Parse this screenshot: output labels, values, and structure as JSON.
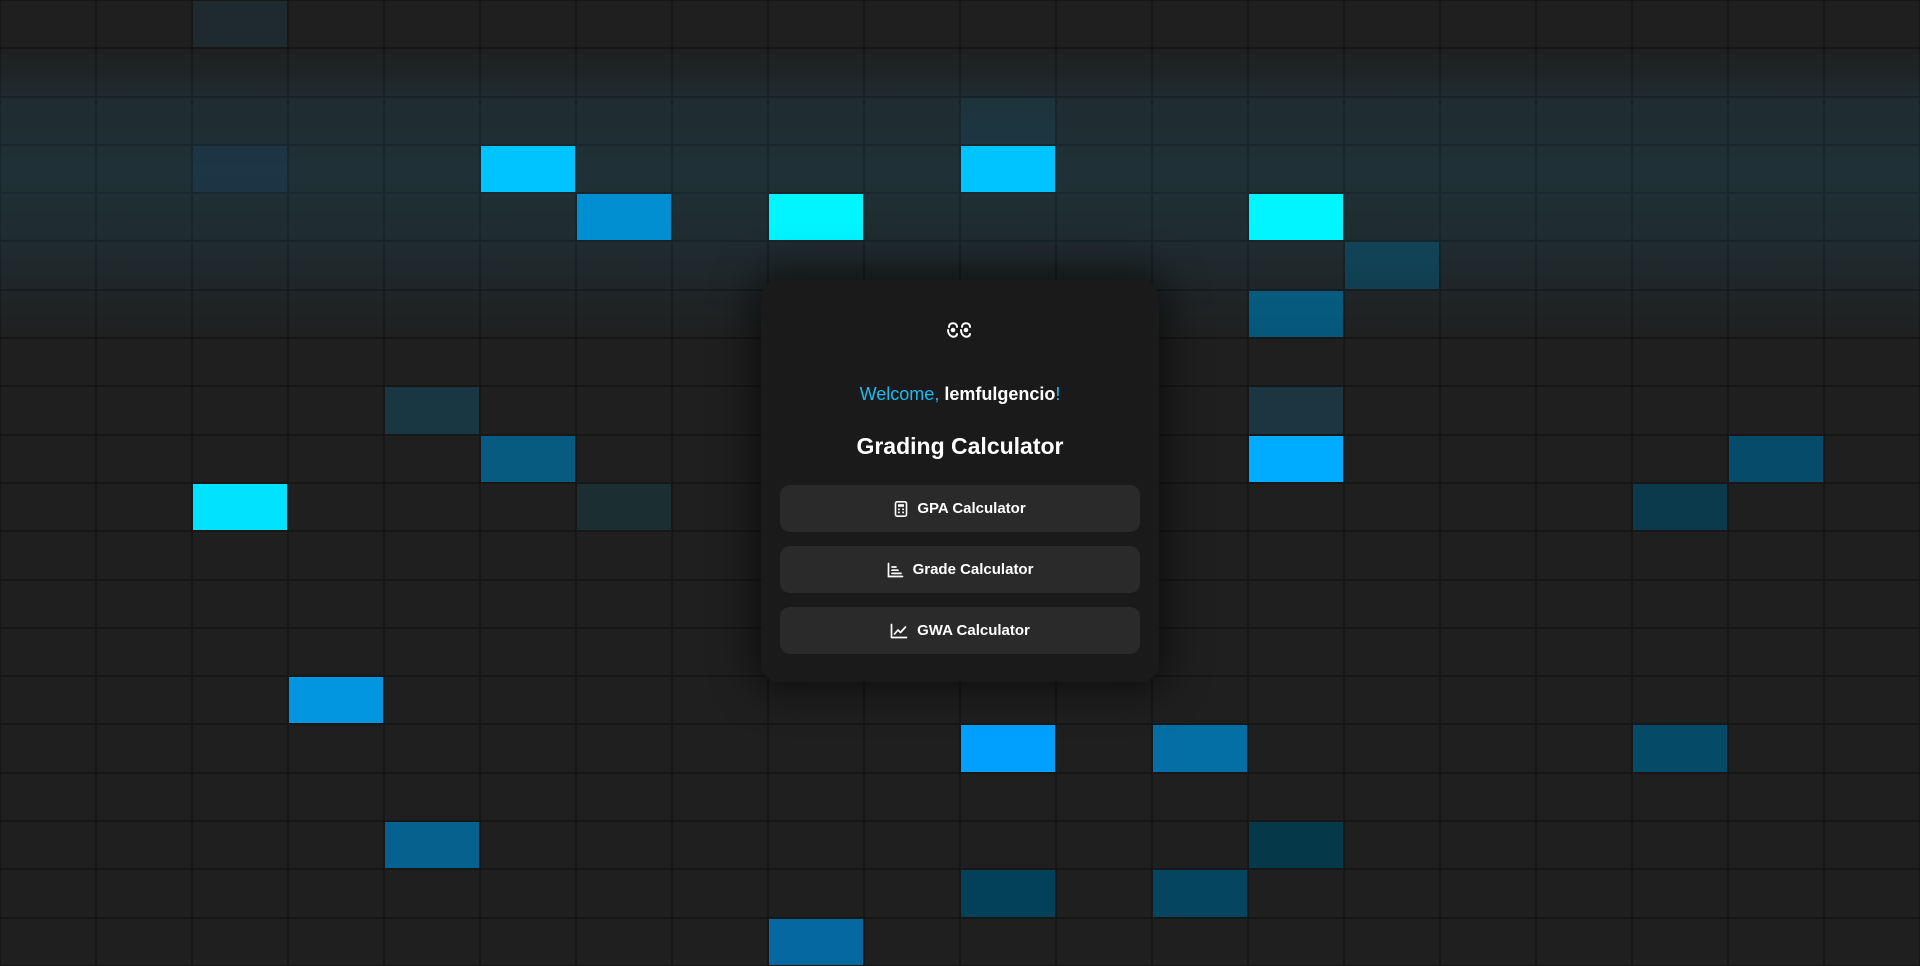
{
  "background": {
    "rows": 20,
    "cols": 20,
    "cell_color": "#1f1f1f",
    "lit_cells": [
      {
        "r": 0,
        "c": 2,
        "color": "#1e2a30"
      },
      {
        "r": 2,
        "c": 10,
        "color": "#1d272d"
      },
      {
        "r": 3,
        "c": 2,
        "color": "#1c2530"
      },
      {
        "r": 3,
        "c": 5,
        "color": "#00bfff"
      },
      {
        "r": 3,
        "c": 10,
        "color": "#00bfff"
      },
      {
        "r": 4,
        "c": 6,
        "color": "#0088cc"
      },
      {
        "r": 4,
        "c": 8,
        "color": "#00f4ff"
      },
      {
        "r": 4,
        "c": 13,
        "color": "#00f4ff"
      },
      {
        "r": 5,
        "c": 14,
        "color": "#11394a"
      },
      {
        "r": 6,
        "c": 13,
        "color": "#06577a"
      },
      {
        "r": 8,
        "c": 4,
        "color": "#183742"
      },
      {
        "r": 8,
        "c": 13,
        "color": "#1b3640"
      },
      {
        "r": 9,
        "c": 5,
        "color": "#075a80"
      },
      {
        "r": 9,
        "c": 13,
        "color": "#00acff"
      },
      {
        "r": 9,
        "c": 18,
        "color": "#064c6a"
      },
      {
        "r": 10,
        "c": 2,
        "color": "#00e2ff"
      },
      {
        "r": 10,
        "c": 6,
        "color": "#1b2e32"
      },
      {
        "r": 10,
        "c": 17,
        "color": "#0b3a4c"
      },
      {
        "r": 14,
        "c": 3,
        "color": "#0396e0"
      },
      {
        "r": 15,
        "c": 10,
        "color": "#01a0ff"
      },
      {
        "r": 15,
        "c": 12,
        "color": "#046fa5"
      },
      {
        "r": 15,
        "c": 17,
        "color": "#054a66"
      },
      {
        "r": 17,
        "c": 4,
        "color": "#05628f"
      },
      {
        "r": 17,
        "c": 13,
        "color": "#053849"
      },
      {
        "r": 18,
        "c": 10,
        "color": "#03405a"
      },
      {
        "r": 18,
        "c": 12,
        "color": "#05455f"
      },
      {
        "r": 19,
        "c": 8,
        "color": "#0568a0"
      }
    ]
  },
  "card": {
    "logo_icon": "eyes-logo-icon",
    "welcome_prefix": "Welcome, ",
    "username": "lemfulgencio",
    "welcome_suffix": "!",
    "title": "Grading Calculator",
    "buttons": [
      {
        "label": "GPA Calculator",
        "icon": "calculator-icon"
      },
      {
        "label": "Grade Calculator",
        "icon": "list-chart-icon"
      },
      {
        "label": "GWA Calculator",
        "icon": "line-chart-icon"
      }
    ]
  },
  "colors": {
    "accent": "#22b8f0",
    "card_bg": "#1a1a1a",
    "button_bg": "#2a2a2a",
    "page_bg": "#1c1c1c"
  }
}
